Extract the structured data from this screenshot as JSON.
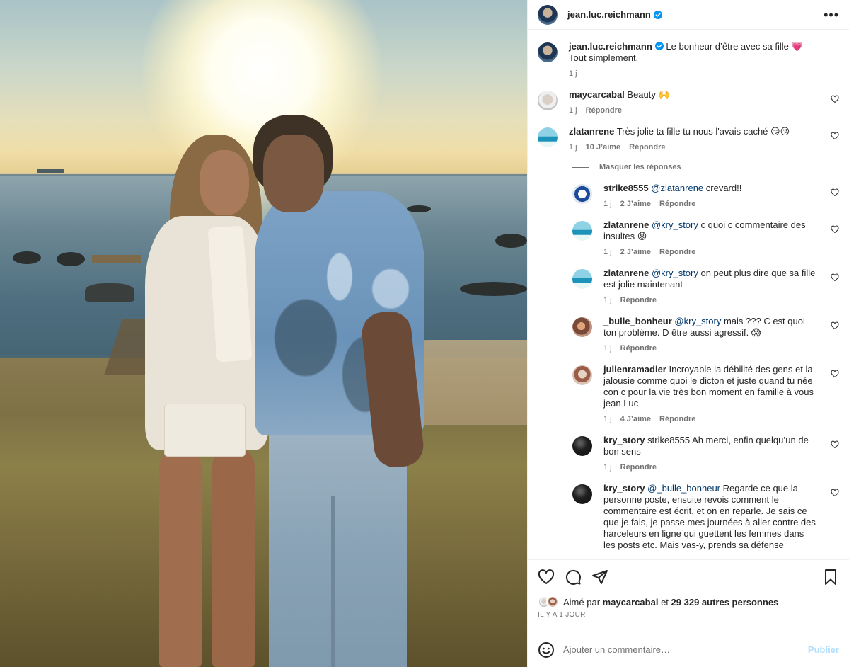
{
  "post": {
    "owner": "jean.luc.reichmann",
    "caption": "Le bonheur d’être avec sa fille 💗",
    "caption_line2": "Tout simplement.",
    "caption_age": "1 j"
  },
  "comments": [
    {
      "user": "maycarcabal",
      "text": "Beauty 🙌",
      "age": "1 j",
      "likes": "",
      "reply": "Répondre"
    },
    {
      "user": "zlatanrene",
      "text": "Très jolie ta fille tu nous l'avais caché 😏😘",
      "age": "1 j",
      "likes": "10 J’aime",
      "reply": "Répondre"
    }
  ],
  "toggle_replies_label": "Masquer les réponses",
  "replies": [
    {
      "user": "strike8555",
      "mention": "@zlatanrene",
      "text": " crevard!!",
      "age": "1 j",
      "likes": "2 J’aime",
      "reply": "Répondre"
    },
    {
      "user": "zlatanrene",
      "mention": "@kry_story",
      "text": " c quoi c commentaire des insultes 😡",
      "age": "1 j",
      "likes": "2 J’aime",
      "reply": "Répondre"
    },
    {
      "user": "zlatanrene",
      "mention": "@kry_story",
      "text": " on peut plus dire que sa fille est jolie maintenant",
      "age": "1 j",
      "likes": "",
      "reply": "Répondre"
    },
    {
      "user": "_bulle_bonheur",
      "mention": "@kry_story",
      "text": " mais ??? C est quoi ton problème. D être aussi agressif. 😱",
      "age": "1 j",
      "likes": "",
      "reply": "Répondre"
    },
    {
      "user": "julienramadier",
      "mention": "",
      "text": " Incroyable la débilité des gens et la jalousie comme quoi le dicton et juste quand tu née con c pour la vie très bon moment en famille à vous jean Luc",
      "age": "1 j",
      "likes": "4 J’aime",
      "reply": "Répondre"
    },
    {
      "user": "kry_story",
      "mention": "",
      "text": " strike8555 Ah merci, enfin quelqu’un de bon sens",
      "age": "1 j",
      "likes": "",
      "reply": "Répondre"
    },
    {
      "user": "kry_story",
      "mention": "@_bulle_bonheur",
      "text": " Regarde ce que la personne poste, ensuite revois comment le commentaire est écrit, et on en reparle. Je sais ce que je fais, je passe mes journées à aller contre des harceleurs en ligne qui guettent les femmes dans les posts etc. Mais vas-y, prends sa défense",
      "age": "",
      "likes": "",
      "reply": ""
    }
  ],
  "likes": {
    "prefix": "Aimé par",
    "user": "maycarcabal",
    "middle": "et",
    "count": "29 329 autres personnes"
  },
  "date": "IL Y A 1 JOUR",
  "add_comment": {
    "placeholder": "Ajouter un commentaire…",
    "publish_label": "Publier"
  },
  "icons": {
    "verified": "verified-badge-icon",
    "heart": "heart-icon",
    "comment": "comment-icon",
    "share": "share-icon",
    "save": "bookmark-icon",
    "emoji": "emoji-icon",
    "more": "more-options-icon"
  },
  "colors": {
    "verified": "#0095f6",
    "mention": "#00376b",
    "secondary_text": "#737373",
    "publish_disabled": "#b2dffc"
  }
}
